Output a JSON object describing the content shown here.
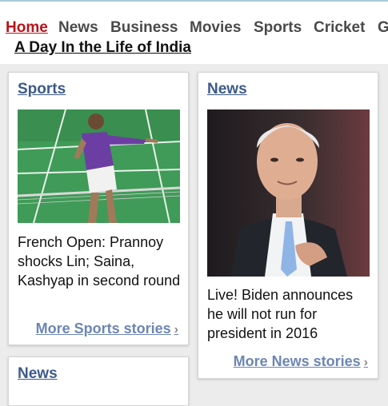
{
  "nav": {
    "items": [
      {
        "label": "Home",
        "active": true
      },
      {
        "label": "News"
      },
      {
        "label": "Business"
      },
      {
        "label": "Movies"
      },
      {
        "label": "Sports"
      },
      {
        "label": "Cricket"
      },
      {
        "label": "G"
      }
    ]
  },
  "page_title": "A Day In the Life of India",
  "cards": {
    "sports": {
      "section": "Sports",
      "headline": "French Open: Prannoy shocks Lin; Saina, Kashyap in second round",
      "more": "More Sports stories",
      "image_alt": "badminton player icon"
    },
    "news": {
      "section": "News",
      "headline": "Live! Biden announces he will not run for president in 2016",
      "more": "More News stories",
      "image_alt": "speaker icon"
    },
    "news2": {
      "section": "News"
    }
  },
  "colors": {
    "accent_link": "#3c5a8a",
    "more_link": "#6c86b4",
    "active_nav": "#b8141b",
    "court_green": "#3f9b57"
  }
}
